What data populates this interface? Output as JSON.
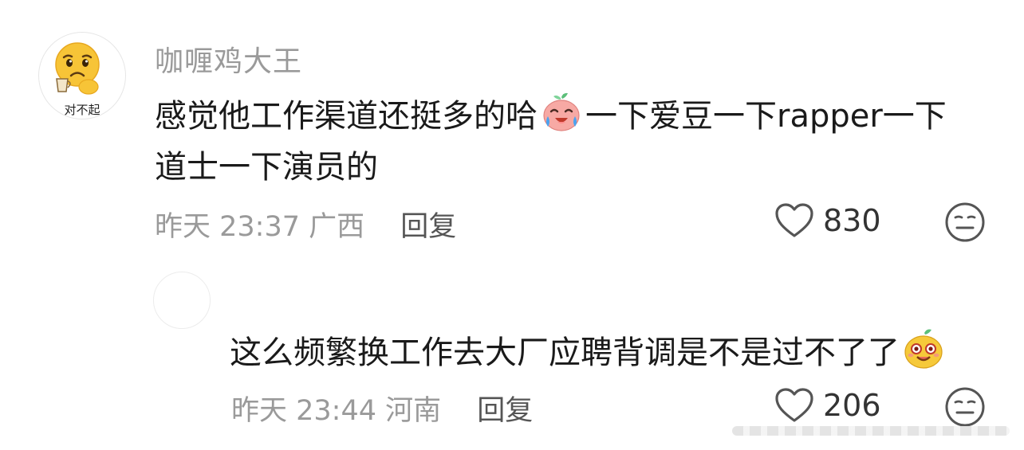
{
  "comment": {
    "avatar": {
      "icon": "sad-face-holding-cup",
      "caption": "对不起"
    },
    "username": "咖喱鸡大王",
    "text_line1_part1": "感觉他工作渠道还挺多的哈",
    "inline_emoji": "crying-laughing-peach-emoji",
    "text_line1_part2": "一下爱豆一下rapper一下",
    "text_line2": "道士一下演员的",
    "time": "昨天 23:37",
    "location": "广西",
    "reply_label": "回复",
    "like_count": "830",
    "like_icon": "heart-outline-icon",
    "reaction_icon": "neutral-face-icon"
  },
  "reply": {
    "avatar": {
      "icon": "blank-avatar"
    },
    "text": "这么频繁换工作去大厂应聘背调是不是过不了了",
    "inline_emoji": "smug-yellow-sprout-emoji",
    "time": "昨天 23:44",
    "location": "河南",
    "reply_label": "回复",
    "like_count": "206",
    "like_icon": "heart-outline-icon",
    "reaction_icon": "neutral-face-icon"
  },
  "colors": {
    "meta_text": "#9a9a9a",
    "body_text": "#1a1a1a",
    "reply_link": "#555555"
  }
}
